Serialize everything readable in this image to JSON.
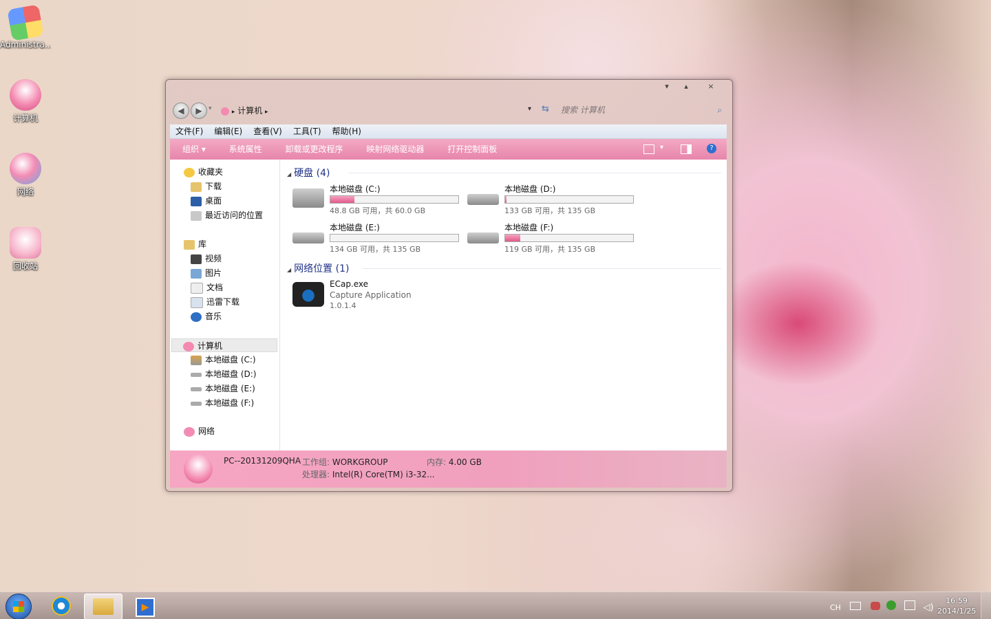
{
  "desktop": {
    "icons": [
      {
        "label": "Administra..."
      },
      {
        "label": "计算机"
      },
      {
        "label": "网络"
      },
      {
        "label": "回收站"
      }
    ]
  },
  "window": {
    "controls": {
      "minimize": "▾",
      "maximize": "▴",
      "close": "×"
    },
    "address": {
      "current": "计算机",
      "separator": "▸"
    },
    "search_placeholder": "搜索 计算机",
    "menu": [
      "文件(F)",
      "编辑(E)",
      "查看(V)",
      "工具(T)",
      "帮助(H)"
    ],
    "toolbar": {
      "organize": "组织 ▾",
      "items": [
        "系统属性",
        "卸载或更改程序",
        "映射网络驱动器",
        "打开控制面板"
      ]
    },
    "nav": {
      "favorites": {
        "title": "收藏夹",
        "items": [
          "下载",
          "桌面",
          "最近访问的位置"
        ]
      },
      "libraries": {
        "title": "库",
        "items": [
          "视频",
          "图片",
          "文档",
          "迅雷下载",
          "音乐"
        ]
      },
      "computer": {
        "title": "计算机",
        "items": [
          "本地磁盘 (C:)",
          "本地磁盘 (D:)",
          "本地磁盘 (E:)",
          "本地磁盘 (F:)"
        ]
      },
      "network": {
        "title": "网络"
      }
    },
    "groups": {
      "hard_disks": "硬盘 (4)",
      "network_locations": "网络位置 (1)"
    },
    "drives": [
      {
        "name": "本地磁盘 (C:)",
        "free": "48.8 GB 可用，共 60.0 GB",
        "used_fraction": 0.19
      },
      {
        "name": "本地磁盘 (D:)",
        "free": "133 GB 可用，共 135 GB",
        "used_fraction": 0.01
      },
      {
        "name": "本地磁盘 (E:)",
        "free": "134 GB 可用，共 135 GB",
        "used_fraction": 0.0
      },
      {
        "name": "本地磁盘 (F:)",
        "free": "119 GB 可用，共 135 GB",
        "used_fraction": 0.12
      }
    ],
    "network_item": {
      "name": "ECap.exe",
      "desc": "Capture Application",
      "version": "1.0.1.4"
    },
    "details": {
      "pc_name": "PC--20131209QHA",
      "workgroup_label": "工作组:",
      "workgroup_value": "WORKGROUP",
      "memory_label": "内存:",
      "memory_value": "4.00 GB",
      "cpu_label": "处理器:",
      "cpu_value": "Intel(R) Core(TM) i3-32..."
    }
  },
  "taskbar": {
    "tray_lang": "CH",
    "time": "16:59",
    "date": "2014/1/25"
  },
  "colors": {
    "accent_pink": "#e785ab",
    "group_title": "#1e3287"
  }
}
